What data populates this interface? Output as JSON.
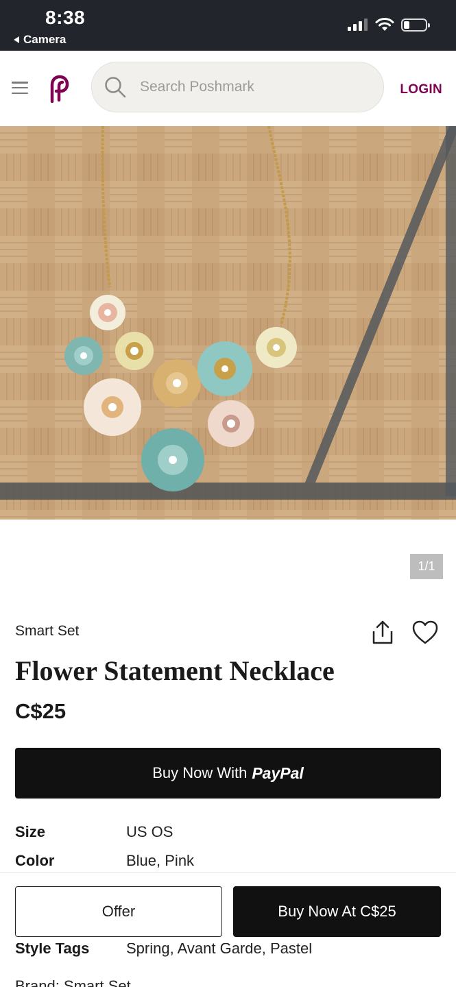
{
  "status_bar": {
    "time": "8:38",
    "back_label": "Camera"
  },
  "header": {
    "search_placeholder": "Search Poshmark",
    "login_label": "LOGIN"
  },
  "colors": {
    "brand": "#7f0353",
    "status_bar": "#22252c",
    "button_dark": "#111111"
  },
  "photo": {
    "counter": "1/1"
  },
  "listing": {
    "brand": "Smart Set",
    "title": "Flower Statement Necklace",
    "price": "C$25",
    "paypal_prefix": "Buy Now With",
    "paypal_brand": "PayPal"
  },
  "details": [
    {
      "label": "Size",
      "value": "US OS"
    },
    {
      "label": "Color",
      "value": "Blue, Pink"
    },
    {
      "label": "Style Tags",
      "value": "Spring, Avant Garde, Pastel"
    }
  ],
  "brand_line": "Brand: Smart Set",
  "actions": {
    "offer_label": "Offer",
    "buy_label": "Buy Now At C$25"
  }
}
